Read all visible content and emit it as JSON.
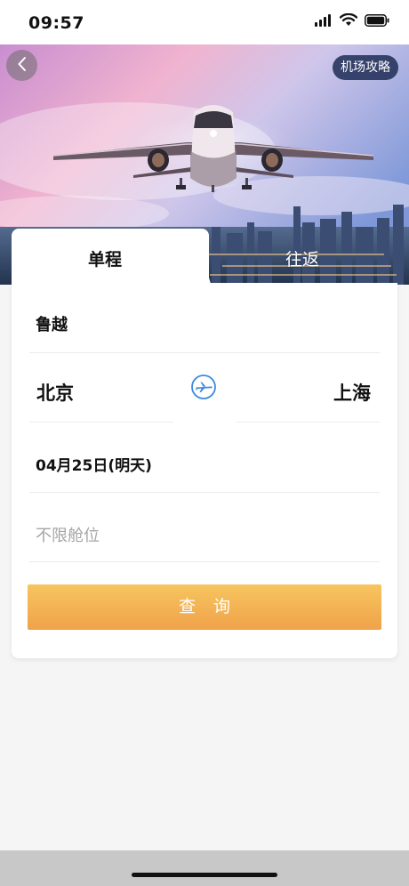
{
  "status_bar": {
    "time": "09:57"
  },
  "header": {
    "airport_guide_label": "机场攻略"
  },
  "tabs": {
    "oneway": "单程",
    "roundtrip": "往返",
    "active": "oneway"
  },
  "form": {
    "passenger_name": "鲁越",
    "departure_city": "北京",
    "arrival_city": "上海",
    "date": "04月25日(明天)",
    "cabin_placeholder": "不限舱位"
  },
  "search_button_label": "查询",
  "icons": {
    "back": "chevron-left-icon",
    "swap": "airplane-icon",
    "signal": "signal-icon",
    "wifi": "wifi-icon",
    "battery": "battery-icon"
  },
  "colors": {
    "accent_orange_top": "#f7c55f",
    "accent_orange_bottom": "#f0a24a",
    "swap_icon_blue": "#3d8be0",
    "guide_button_bg": "#1e2d55"
  }
}
